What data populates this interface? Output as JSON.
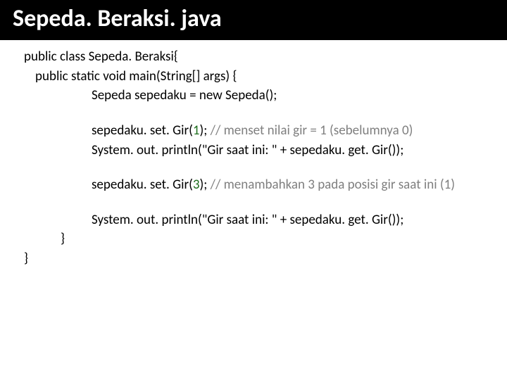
{
  "title": "Sepeda. Beraksi. java",
  "lines": {
    "l1": "public class Sepeda. Beraksi{",
    "l2": "public static void main(String[] args) {",
    "l3": "Sepeda sepedaku = new Sepeda();",
    "l4a": "sepedaku. set. Gir(",
    "l4arg": "1",
    "l4b": "); ",
    "l4c": "// menset nilai gir = 1 (sebelumnya 0)",
    "l5": "System. out. println(\"Gir saat ini: \" + sepedaku. get. Gir());",
    "l6a": "sepedaku. set. Gir(",
    "l6arg": "3",
    "l6b": "); ",
    "l6c": "// menambahkan 3 pada posisi gir saat ini (1)",
    "l7": "System. out. println(\"Gir saat ini: \" + sepedaku. get. Gir());",
    "l8": "}",
    "l9": "}"
  }
}
